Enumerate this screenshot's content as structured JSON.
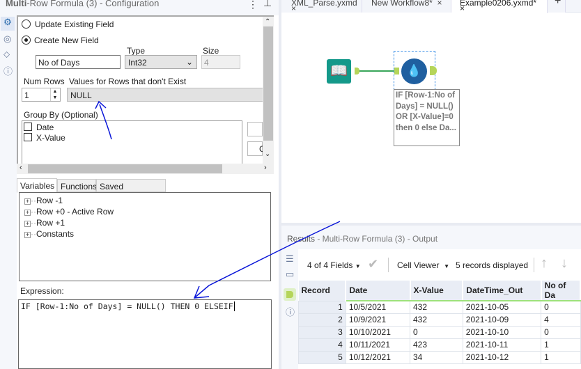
{
  "config_panel": {
    "title_bold": "Multi",
    "title_rest": "-Row Formula (3) - Configuration",
    "menu_icon": "⋮",
    "pin_icon": "⊥",
    "update_existing_label": "Update Existing Field",
    "create_new_label": "Create New  Field",
    "new_field_value": "No of Days",
    "type_label": "Type",
    "type_value": "Int32",
    "size_label": "Size",
    "size_value": "4",
    "num_rows_label": "Num Rows",
    "num_rows_value": "1",
    "values_label": "Values for Rows that don't Exist",
    "values_value": "NULL",
    "group_by_label": "Group By (Optional)",
    "group_by_fields": [
      "Date",
      "X-Value"
    ],
    "button_2_label": "C",
    "tabs": [
      "Variables",
      "Functions",
      "Saved Expressions"
    ],
    "variables": [
      "Row -1",
      "Row +0 - Active Row",
      "Row +1",
      "Constants"
    ],
    "expression_label": "Expression:",
    "expression_value": "IF [Row-1:No of Days] = NULL() THEN 0 ELSEIF"
  },
  "workflow_tabs": [
    {
      "label": "XML_Parse.yxmd",
      "close": "×"
    },
    {
      "label": "New Workflow8*",
      "close": "×"
    },
    {
      "label": "Example0206.yxmd*",
      "close": "×"
    }
  ],
  "add_tab": "+",
  "annotation": "IF [Row-1:No of Days] = NULL() OR [X-Value]=0 then 0 else Da...",
  "results": {
    "title_bold": "Results",
    "title_rest": " - Multi-Row Formula (3) - Output",
    "fields": "4 of 4 Fields",
    "viewer": "Cell Viewer",
    "records": "5 records displayed",
    "columns": [
      "Record",
      "Date",
      "X-Value",
      "DateTime_Out",
      "No of Da"
    ],
    "rows": [
      [
        "1",
        "10/5/2021",
        "432",
        "2021-10-05",
        "0"
      ],
      [
        "2",
        "10/9/2021",
        "432",
        "2021-10-09",
        "4"
      ],
      [
        "3",
        "10/10/2021",
        "0",
        "2021-10-10",
        "0"
      ],
      [
        "4",
        "10/11/2021",
        "423",
        "2021-10-11",
        "1"
      ],
      [
        "5",
        "10/12/2021",
        "34",
        "2021-10-12",
        "1"
      ]
    ]
  },
  "colors": {
    "accent": "#1f5fa0",
    "tool_green": "#14998a",
    "anchor": "#b5d55a",
    "annotation_ink": "#0a16d8"
  }
}
